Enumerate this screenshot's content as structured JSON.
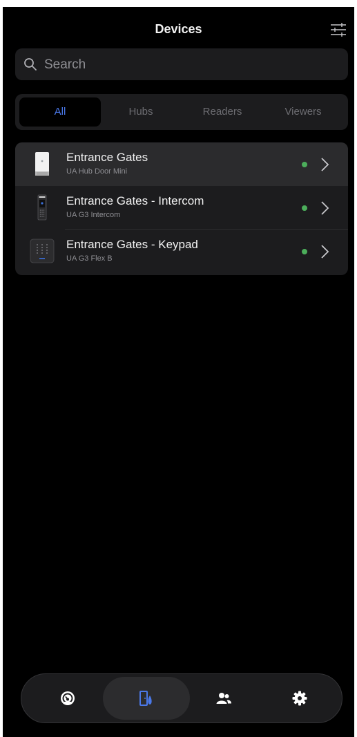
{
  "header": {
    "title": "Devices",
    "filter_icon": "sliders-icon"
  },
  "search": {
    "placeholder": "Search",
    "value": ""
  },
  "tabs": [
    {
      "label": "All",
      "active": true
    },
    {
      "label": "Hubs",
      "active": false
    },
    {
      "label": "Readers",
      "active": false
    },
    {
      "label": "Viewers",
      "active": false
    }
  ],
  "devices": [
    {
      "name": "Entrance Gates",
      "model": "UA Hub Door Mini",
      "status": "online",
      "icon": "hub-door-mini-icon"
    },
    {
      "name": "Entrance Gates - Intercom",
      "model": "UA G3 Intercom",
      "status": "online",
      "icon": "intercom-icon"
    },
    {
      "name": "Entrance Gates - Keypad",
      "model": "UA G3 Flex B",
      "status": "online",
      "icon": "keypad-icon"
    }
  ],
  "tabbar": {
    "items": [
      {
        "icon": "dashboard-icon",
        "active": false
      },
      {
        "icon": "door-access-icon",
        "active": true
      },
      {
        "icon": "users-icon",
        "active": false
      },
      {
        "icon": "settings-gear-icon",
        "active": false
      }
    ]
  },
  "colors": {
    "accent": "#4a78e8",
    "status_online": "#4cae5b",
    "background": "#000000",
    "surface": "#1c1c1e"
  }
}
